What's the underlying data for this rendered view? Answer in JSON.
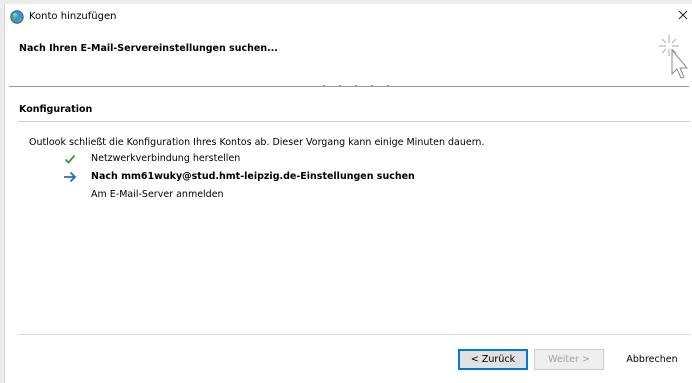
{
  "window": {
    "title": "Konto hinzufügen",
    "close_glyph": "✕"
  },
  "header": {
    "title": "Nach Ihren E-Mail-Servereinstellungen suchen..."
  },
  "section": {
    "title": "Konfiguration",
    "description": "Outlook schließt die Konfiguration Ihres Kontos ab. Dieser Vorgang kann einige Minuten dauern."
  },
  "steps": [
    {
      "label": "Netzwerkverbindung herstellen",
      "status": "done",
      "icon": "checkmark-icon"
    },
    {
      "label": "Nach mm61wuky@stud.hmt-leipzig.de-Einstellungen suchen",
      "status": "current",
      "icon": "arrow-right-icon"
    },
    {
      "label": "Am E-Mail-Server anmelden",
      "status": "pending",
      "icon": ""
    }
  ],
  "buttons": {
    "back": "< Zurück",
    "next": "Weiter >",
    "cancel": "Abbrechen"
  },
  "colors": {
    "check": "#3a9a3a",
    "arrow": "#2b6cb8",
    "accent": "#0078d7"
  }
}
